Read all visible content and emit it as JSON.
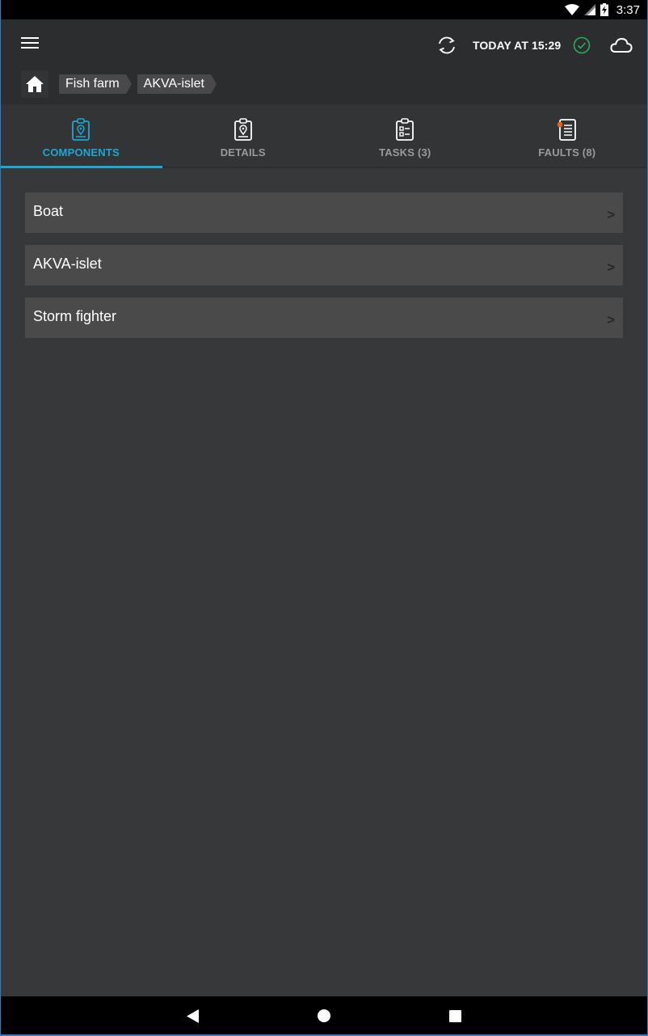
{
  "status_bar": {
    "time": "3:37",
    "icons": [
      "wifi-icon",
      "cellular-signal-icon",
      "battery-charging-icon"
    ]
  },
  "app_bar": {
    "menu_icon": "hamburger-menu-icon",
    "sync_icon": "sync-icon",
    "sync_status": "TODAY AT 15:29",
    "status_icon": "check-circle-icon",
    "cloud_icon": "cloud-icon",
    "colors": {
      "status_ok": "#27ae60"
    }
  },
  "breadcrumb": {
    "home_icon": "home-icon",
    "items": [
      {
        "label": "Fish farm"
      },
      {
        "label": "AKVA-islet"
      }
    ]
  },
  "tabs": [
    {
      "label": "COMPONENTS",
      "icon": "clipboard-location-icon",
      "active": true
    },
    {
      "label": "DETAILS",
      "icon": "clipboard-location-icon",
      "active": false
    },
    {
      "label": "TASKS (3)",
      "icon": "clipboard-checklist-icon",
      "active": false
    },
    {
      "label": "FAULTS (8)",
      "icon": "document-list-alert-icon",
      "active": false
    }
  ],
  "colors": {
    "accent": "#1ba8d4",
    "fault_dot": "#e8611f"
  },
  "components": [
    {
      "label": "Boat",
      "chevron": ">"
    },
    {
      "label": "AKVA-islet",
      "chevron": ">"
    },
    {
      "label": "Storm fighter",
      "chevron": ">"
    }
  ],
  "nav_bar": {
    "icons": [
      "back-icon",
      "home-circle-icon",
      "recent-apps-icon"
    ]
  }
}
